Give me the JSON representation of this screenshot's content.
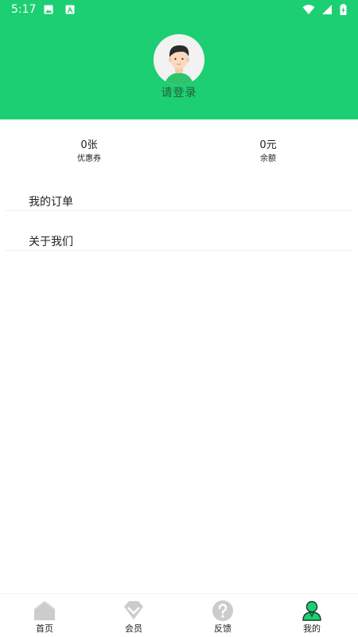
{
  "status_bar": {
    "time": "5:17",
    "left_icons": [
      "image-icon",
      "font-a-icon"
    ],
    "right_icons": [
      "wifi-icon",
      "signal-icon",
      "battery-charging-icon"
    ]
  },
  "profile": {
    "login_label": "请登录",
    "avatar_icon": "user-avatar-icon"
  },
  "stats": [
    {
      "value": "0张",
      "label": "优惠券"
    },
    {
      "value": "0元",
      "label": "余额"
    }
  ],
  "menu": [
    {
      "label": "我的订单"
    },
    {
      "label": "关于我们"
    }
  ],
  "bottom_nav": [
    {
      "label": "首页",
      "icon": "home-icon",
      "active": false
    },
    {
      "label": "会员",
      "icon": "diamond-icon",
      "active": false
    },
    {
      "label": "反馈",
      "icon": "help-icon",
      "active": false
    },
    {
      "label": "我的",
      "icon": "person-icon",
      "active": true
    }
  ],
  "colors": {
    "header_bg": "#1ccf72",
    "active_nav": "#1ccf72",
    "inactive_nav": "#cccccc",
    "text": "#222222"
  }
}
